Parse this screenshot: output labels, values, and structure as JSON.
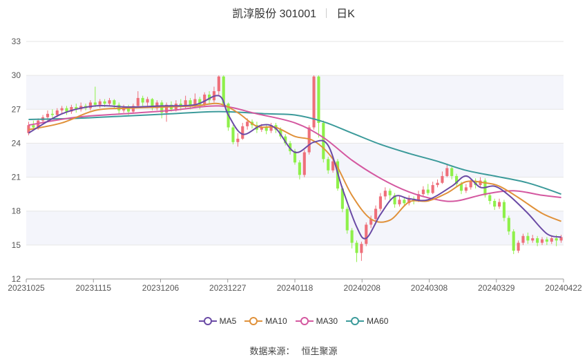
{
  "title": {
    "name": "凯淳股份 301001",
    "period": "日K"
  },
  "source": {
    "label": "数据来源：",
    "value": "恒生聚源"
  },
  "chart_data": {
    "type": "candlestick",
    "ylim": [
      12,
      33
    ],
    "yticks": [
      12,
      15,
      18,
      21,
      24,
      27,
      30,
      33
    ],
    "xticks": [
      "20231025",
      "20231115",
      "20231206",
      "20231227",
      "20240118",
      "20240208",
      "20240308",
      "20240329",
      "20240422"
    ],
    "xtick_index": [
      0,
      14,
      28,
      42,
      56,
      70,
      84,
      98,
      112
    ],
    "bands": [
      [
        27,
        30
      ],
      [
        21,
        24
      ],
      [
        15,
        18
      ]
    ],
    "colors": {
      "up": "#ee6f7a",
      "down": "#8ef04a",
      "ma5": "#6a4aa5",
      "ma10": "#e0913a",
      "ma30": "#d458a0",
      "ma60": "#3b9a9a"
    },
    "legend": [
      {
        "name": "MA5",
        "color": "#6a4aa5"
      },
      {
        "name": "MA10",
        "color": "#e0913a"
      },
      {
        "name": "MA30",
        "color": "#d458a0"
      },
      {
        "name": "MA60",
        "color": "#3b9a9a"
      }
    ],
    "candles": [
      [
        24.9,
        25.6,
        25.9,
        24.7
      ],
      [
        25.6,
        25.4,
        26.0,
        25.1
      ],
      [
        25.4,
        26.0,
        26.2,
        25.2
      ],
      [
        26.0,
        26.3,
        26.5,
        25.8
      ],
      [
        26.3,
        26.6,
        26.9,
        26.0
      ],
      [
        26.6,
        26.5,
        27.0,
        26.2
      ],
      [
        26.5,
        26.9,
        27.1,
        26.3
      ],
      [
        26.9,
        27.1,
        27.3,
        26.6
      ],
      [
        27.1,
        26.8,
        27.3,
        26.5
      ],
      [
        26.8,
        27.2,
        27.4,
        26.6
      ],
      [
        27.2,
        27.0,
        27.5,
        26.7
      ],
      [
        27.0,
        27.3,
        27.6,
        26.8
      ],
      [
        27.3,
        27.1,
        27.5,
        26.9
      ],
      [
        27.1,
        27.6,
        27.8,
        26.9
      ],
      [
        27.6,
        27.4,
        29.0,
        27.2
      ],
      [
        27.4,
        27.7,
        27.9,
        27.1
      ],
      [
        27.7,
        27.5,
        27.9,
        27.2
      ],
      [
        27.5,
        27.8,
        28.0,
        27.3
      ],
      [
        27.8,
        27.4,
        27.9,
        27.1
      ],
      [
        27.4,
        26.9,
        27.6,
        26.6
      ],
      [
        26.9,
        27.2,
        27.4,
        26.7
      ],
      [
        27.2,
        26.8,
        27.4,
        26.5
      ],
      [
        26.8,
        27.3,
        27.5,
        26.6
      ],
      [
        27.3,
        28.0,
        28.6,
        27.1
      ],
      [
        28.0,
        27.6,
        28.2,
        27.3
      ],
      [
        27.6,
        27.9,
        28.1,
        27.3
      ],
      [
        27.9,
        27.1,
        28.0,
        26.9
      ],
      [
        27.1,
        27.6,
        27.8,
        26.9
      ],
      [
        27.6,
        26.7,
        27.8,
        26.2
      ],
      [
        26.7,
        27.4,
        27.6,
        25.9
      ],
      [
        27.4,
        27.0,
        27.7,
        26.8
      ],
      [
        27.0,
        27.5,
        27.8,
        26.8
      ],
      [
        27.5,
        27.2,
        27.9,
        26.9
      ],
      [
        27.2,
        27.8,
        28.2,
        27.0
      ],
      [
        27.8,
        27.3,
        28.0,
        27.0
      ],
      [
        27.3,
        27.9,
        28.4,
        27.1
      ],
      [
        27.9,
        27.4,
        28.1,
        27.0
      ],
      [
        27.4,
        28.3,
        28.5,
        27.2
      ],
      [
        28.3,
        27.8,
        28.6,
        27.4
      ],
      [
        27.8,
        28.6,
        29.0,
        27.6
      ],
      [
        28.6,
        29.9,
        30.0,
        28.2
      ],
      [
        29.9,
        27.5,
        30.0,
        27.3
      ],
      [
        27.5,
        25.4,
        27.6,
        25.1
      ],
      [
        25.4,
        24.1,
        25.6,
        23.9
      ],
      [
        24.1,
        24.4,
        24.9,
        23.7
      ],
      [
        24.4,
        25.5,
        25.8,
        24.3
      ],
      [
        25.5,
        25.9,
        26.2,
        25.2
      ],
      [
        25.9,
        25.6,
        26.1,
        25.3
      ],
      [
        25.6,
        25.2,
        25.9,
        24.9
      ],
      [
        25.2,
        25.4,
        25.7,
        25.0
      ],
      [
        25.4,
        25.1,
        25.6,
        24.8
      ],
      [
        25.1,
        25.6,
        25.8,
        24.9
      ],
      [
        25.6,
        25.2,
        25.8,
        24.9
      ],
      [
        25.2,
        24.6,
        25.4,
        24.4
      ],
      [
        24.6,
        24.0,
        24.8,
        23.8
      ],
      [
        24.0,
        23.3,
        24.2,
        23.0
      ],
      [
        23.3,
        22.3,
        23.5,
        22.1
      ],
      [
        22.3,
        21.2,
        22.5,
        20.8
      ],
      [
        21.2,
        23.2,
        23.4,
        21.0
      ],
      [
        23.2,
        25.4,
        25.6,
        23.0
      ],
      [
        25.4,
        29.9,
        30.0,
        25.2
      ],
      [
        29.9,
        25.8,
        30.0,
        24.5
      ],
      [
        25.8,
        22.6,
        26.0,
        22.3
      ],
      [
        22.6,
        21.6,
        22.8,
        21.3
      ],
      [
        21.6,
        22.4,
        22.6,
        21.4
      ],
      [
        22.4,
        20.0,
        22.6,
        19.8
      ],
      [
        20.0,
        18.2,
        20.2,
        17.9
      ],
      [
        18.2,
        16.3,
        18.4,
        16.0
      ],
      [
        16.3,
        15.2,
        16.5,
        14.7
      ],
      [
        15.2,
        14.3,
        15.4,
        13.5
      ],
      [
        14.3,
        15.1,
        15.3,
        13.6
      ],
      [
        15.1,
        16.8,
        17.0,
        14.9
      ],
      [
        16.8,
        17.3,
        17.6,
        16.5
      ],
      [
        17.3,
        18.2,
        18.5,
        17.0
      ],
      [
        18.2,
        19.3,
        19.6,
        18.0
      ],
      [
        19.3,
        19.8,
        20.1,
        19.0
      ],
      [
        19.8,
        19.4,
        20.0,
        18.9
      ],
      [
        19.4,
        18.6,
        19.6,
        18.3
      ],
      [
        18.6,
        19.0,
        19.4,
        18.4
      ],
      [
        19.0,
        18.7,
        19.2,
        18.4
      ],
      [
        18.7,
        19.1,
        19.4,
        18.5
      ],
      [
        19.1,
        18.9,
        19.3,
        18.6
      ],
      [
        18.9,
        19.5,
        19.8,
        18.8
      ],
      [
        19.5,
        19.9,
        20.2,
        19.3
      ],
      [
        19.9,
        19.6,
        20.4,
        19.4
      ],
      [
        19.6,
        20.3,
        20.6,
        19.5
      ],
      [
        20.3,
        20.5,
        20.8,
        20.1
      ],
      [
        20.5,
        21.1,
        21.5,
        20.4
      ],
      [
        21.1,
        21.8,
        22.2,
        21.0
      ],
      [
        21.8,
        21.1,
        22.0,
        20.8
      ],
      [
        21.1,
        20.4,
        21.3,
        20.2
      ],
      [
        20.4,
        19.8,
        20.6,
        19.5
      ],
      [
        19.8,
        20.1,
        20.4,
        19.6
      ],
      [
        20.1,
        20.6,
        20.9,
        19.9
      ],
      [
        20.6,
        20.3,
        20.9,
        20.0
      ],
      [
        20.3,
        20.7,
        21.0,
        20.1
      ],
      [
        20.7,
        19.4,
        20.9,
        19.2
      ],
      [
        19.4,
        18.9,
        19.6,
        18.6
      ],
      [
        18.9,
        18.4,
        19.1,
        18.1
      ],
      [
        18.4,
        18.8,
        19.1,
        18.2
      ],
      [
        18.8,
        17.4,
        19.0,
        17.1
      ],
      [
        17.4,
        16.2,
        17.6,
        15.9
      ],
      [
        16.2,
        14.5,
        16.4,
        14.2
      ],
      [
        14.5,
        15.2,
        15.4,
        14.3
      ],
      [
        15.2,
        15.8,
        16.0,
        15.0
      ],
      [
        15.8,
        15.4,
        16.1,
        15.1
      ],
      [
        15.4,
        15.6,
        15.9,
        15.2
      ],
      [
        15.6,
        15.2,
        15.8,
        14.9
      ],
      [
        15.2,
        15.5,
        15.7,
        15.0
      ],
      [
        15.5,
        15.3,
        15.7,
        15.0
      ],
      [
        15.3,
        15.6,
        15.8,
        15.1
      ],
      [
        15.6,
        15.4,
        15.9,
        14.9
      ],
      [
        15.4,
        15.7,
        15.9,
        15.2
      ]
    ],
    "ma5": [
      [
        0,
        24.9
      ],
      [
        7,
        26.6
      ],
      [
        14,
        27.3
      ],
      [
        21,
        27.2
      ],
      [
        28,
        27.3
      ],
      [
        35,
        27.4
      ],
      [
        40,
        28.2
      ],
      [
        42,
        26.5
      ],
      [
        45,
        24.8
      ],
      [
        49,
        25.6
      ],
      [
        52,
        25.3
      ],
      [
        56,
        23.2
      ],
      [
        60,
        24.1
      ],
      [
        63,
        23.8
      ],
      [
        66,
        20.0
      ],
      [
        69,
        16.6
      ],
      [
        71,
        15.6
      ],
      [
        74,
        17.7
      ],
      [
        77,
        19.3
      ],
      [
        80,
        19.1
      ],
      [
        84,
        19.0
      ],
      [
        89,
        20.2
      ],
      [
        92,
        21.1
      ],
      [
        95,
        20.1
      ],
      [
        98,
        20.2
      ],
      [
        101,
        19.4
      ],
      [
        105,
        17.8
      ],
      [
        109,
        16.0
      ],
      [
        112,
        15.7
      ]
    ],
    "ma10": [
      [
        0,
        25.2
      ],
      [
        7,
        25.8
      ],
      [
        14,
        26.9
      ],
      [
        21,
        27.1
      ],
      [
        28,
        27.2
      ],
      [
        35,
        27.3
      ],
      [
        40,
        27.5
      ],
      [
        44,
        26.7
      ],
      [
        48,
        25.5
      ],
      [
        52,
        25.4
      ],
      [
        56,
        24.6
      ],
      [
        60,
        24.2
      ],
      [
        64,
        22.6
      ],
      [
        68,
        19.4
      ],
      [
        72,
        17.3
      ],
      [
        76,
        17.2
      ],
      [
        80,
        18.8
      ],
      [
        84,
        18.9
      ],
      [
        88,
        19.6
      ],
      [
        92,
        20.6
      ],
      [
        96,
        20.5
      ],
      [
        99,
        20.2
      ],
      [
        103,
        19.2
      ],
      [
        108,
        17.8
      ],
      [
        112,
        17.1
      ]
    ],
    "ma30": [
      [
        0,
        25.6
      ],
      [
        10,
        26.3
      ],
      [
        20,
        26.6
      ],
      [
        30,
        26.9
      ],
      [
        40,
        27.3
      ],
      [
        48,
        26.6
      ],
      [
        56,
        25.8
      ],
      [
        62,
        24.5
      ],
      [
        68,
        22.5
      ],
      [
        74,
        20.9
      ],
      [
        80,
        19.7
      ],
      [
        86,
        19.0
      ],
      [
        90,
        18.9
      ],
      [
        96,
        19.5
      ],
      [
        102,
        19.8
      ],
      [
        108,
        19.4
      ],
      [
        112,
        19.2
      ]
    ],
    "ma60": [
      [
        0,
        26.1
      ],
      [
        10,
        26.2
      ],
      [
        20,
        26.4
      ],
      [
        30,
        26.6
      ],
      [
        40,
        26.8
      ],
      [
        50,
        26.6
      ],
      [
        56,
        26.5
      ],
      [
        62,
        25.9
      ],
      [
        68,
        24.9
      ],
      [
        74,
        23.9
      ],
      [
        80,
        23.1
      ],
      [
        86,
        22.4
      ],
      [
        92,
        21.6
      ],
      [
        98,
        21.1
      ],
      [
        104,
        20.6
      ],
      [
        108,
        20.1
      ],
      [
        112,
        19.5
      ]
    ]
  }
}
